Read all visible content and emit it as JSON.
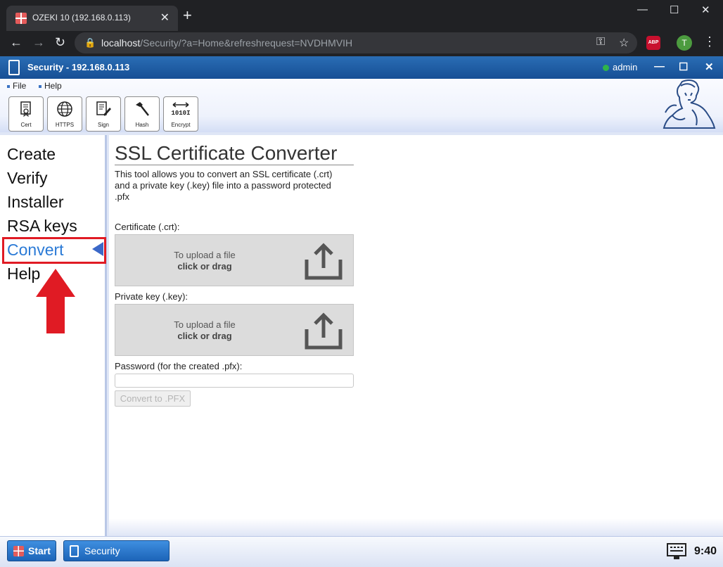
{
  "browser": {
    "tab_title": "OZEKI 10 (192.168.0.113)",
    "tab_close": "✕",
    "new_tab": "+",
    "url_host": "localhost",
    "url_path": "/Security/?a=Home&refreshrequest=NVDHMVIH",
    "abp_label": "ABP",
    "profile_initial": "T"
  },
  "app": {
    "title": "Security - 192.168.0.113",
    "user": "admin",
    "status_color": "#2fb44a"
  },
  "menu": {
    "file": "File",
    "help": "Help"
  },
  "toolbar": {
    "cert": "Cert",
    "https": "HTTPS",
    "sign": "Sign",
    "hash": "Hash",
    "encrypt": "Encrypt",
    "encrypt_glyph": "1010I"
  },
  "sidebar": {
    "items": [
      "Create",
      "Verify",
      "Installer",
      "RSA keys",
      "Convert",
      "Help"
    ],
    "active": "Convert"
  },
  "main": {
    "title": "SSL Certificate Converter",
    "description": "This tool allows you to convert an SSL certificate (.crt) and a private key (.key) file into a password protected .pfx",
    "cert_label": "Certificate (.crt):",
    "key_label": "Private key (.key):",
    "upload_line1": "To upload a file",
    "upload_line2": "click or drag",
    "password_label": "Password (for the created .pfx):",
    "password_value": "",
    "convert_button": "Convert to .PFX"
  },
  "taskbar": {
    "start": "Start",
    "task": "Security",
    "clock": "9:40"
  },
  "colors": {
    "accent": "#2a7ad6",
    "title_bar": "#1f5fa6",
    "highlight": "#e01b24"
  }
}
